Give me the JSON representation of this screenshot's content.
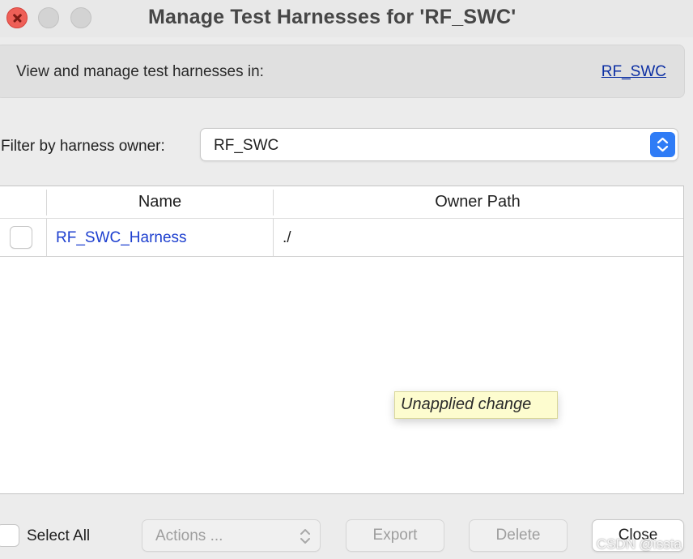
{
  "window": {
    "title": "Manage Test Harnesses for 'RF_SWC'"
  },
  "banner": {
    "text": "View and manage test harnesses in:",
    "link": "RF_SWC"
  },
  "filter": {
    "label": "Filter by harness owner:",
    "selected": "RF_SWC"
  },
  "table": {
    "columns": [
      "Name",
      "Owner Path"
    ],
    "rows": [
      {
        "name": "RF_SWC_Harness",
        "owner_path": "./",
        "checked": false
      }
    ]
  },
  "tooltip": {
    "text": "Unapplied change"
  },
  "footer": {
    "select_all_label": "Select All",
    "actions_label": "Actions ...",
    "export_label": "Export",
    "delete_label": "Delete",
    "close_label": "Close"
  },
  "watermark": {
    "text": "CSDN @issta"
  },
  "colors": {
    "link": "#0b2ea3",
    "harness_name": "#1d3fcf",
    "accent": "#2f7cf6",
    "tooltip_bg": "#fdfccf",
    "close_traffic": "#ee5f57"
  }
}
